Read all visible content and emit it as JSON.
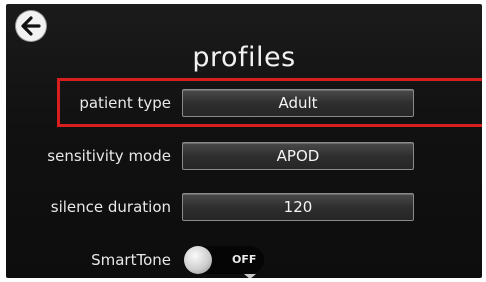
{
  "header": {
    "title": "profiles",
    "back_icon": "back-arrow-icon"
  },
  "settings": [
    {
      "label": "patient type",
      "value": "Adult"
    },
    {
      "label": "sensitivity mode",
      "value": "APOD"
    },
    {
      "label": "silence duration",
      "value": "120"
    }
  ],
  "smarttone": {
    "label": "SmartTone",
    "state": "OFF"
  },
  "colors": {
    "highlight": "#d81e1e",
    "background": "#111111",
    "text": "#f2f2f2"
  }
}
